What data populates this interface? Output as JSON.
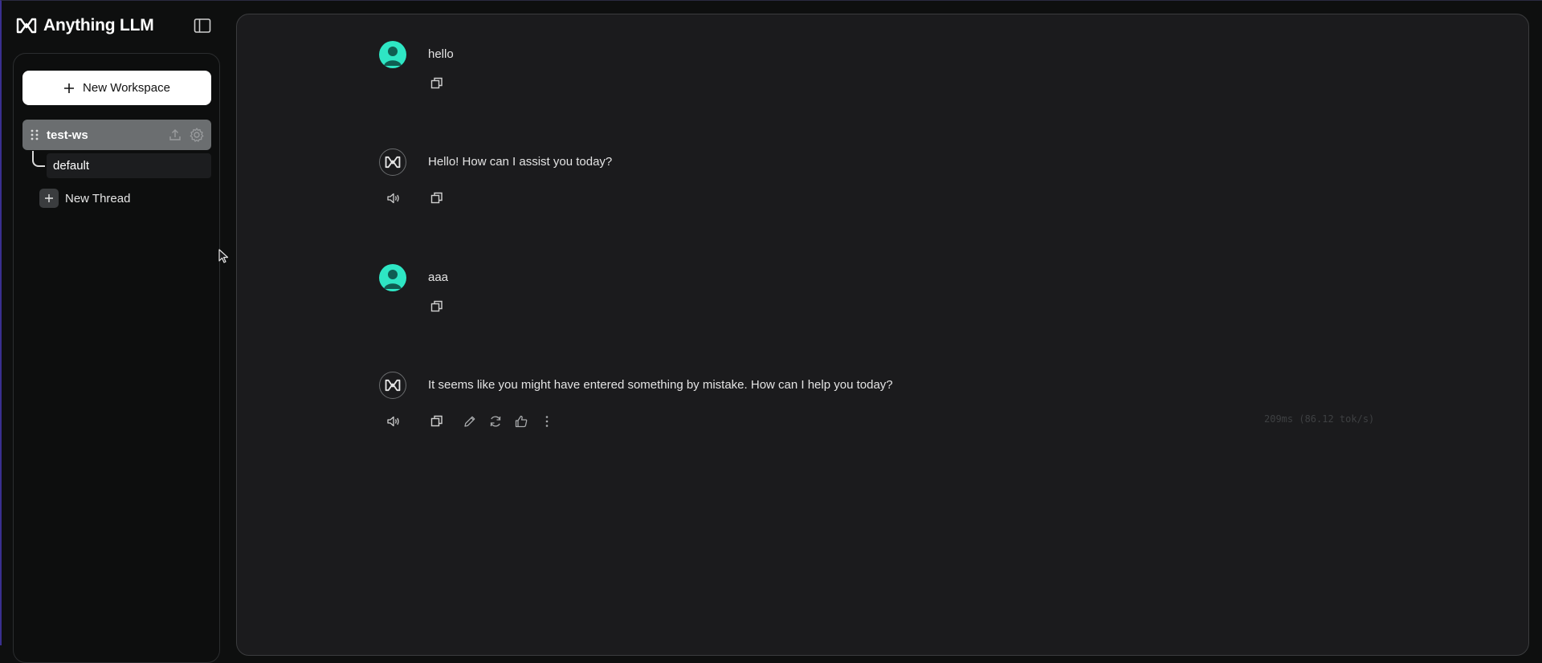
{
  "app": {
    "brand": "Anything LLM"
  },
  "sidebar": {
    "new_workspace_label": "New Workspace",
    "workspace": {
      "name": "test-ws"
    },
    "threads": [
      {
        "label": "default"
      }
    ],
    "new_thread_label": "New Thread"
  },
  "chat": {
    "messages": [
      {
        "role": "user",
        "text": "hello"
      },
      {
        "role": "assistant",
        "text": "Hello! How can I assist you today?"
      },
      {
        "role": "user",
        "text": "aaa"
      },
      {
        "role": "assistant",
        "text": "It seems like you might have entered something by mistake. How can I help you today?"
      }
    ],
    "metrics": "209ms (86.12 tok/s)"
  },
  "colors": {
    "accent_user_avatar": "#2ee6c4",
    "workspace_active_bg": "#6b6e70",
    "panel_bg": "#1b1b1d"
  }
}
